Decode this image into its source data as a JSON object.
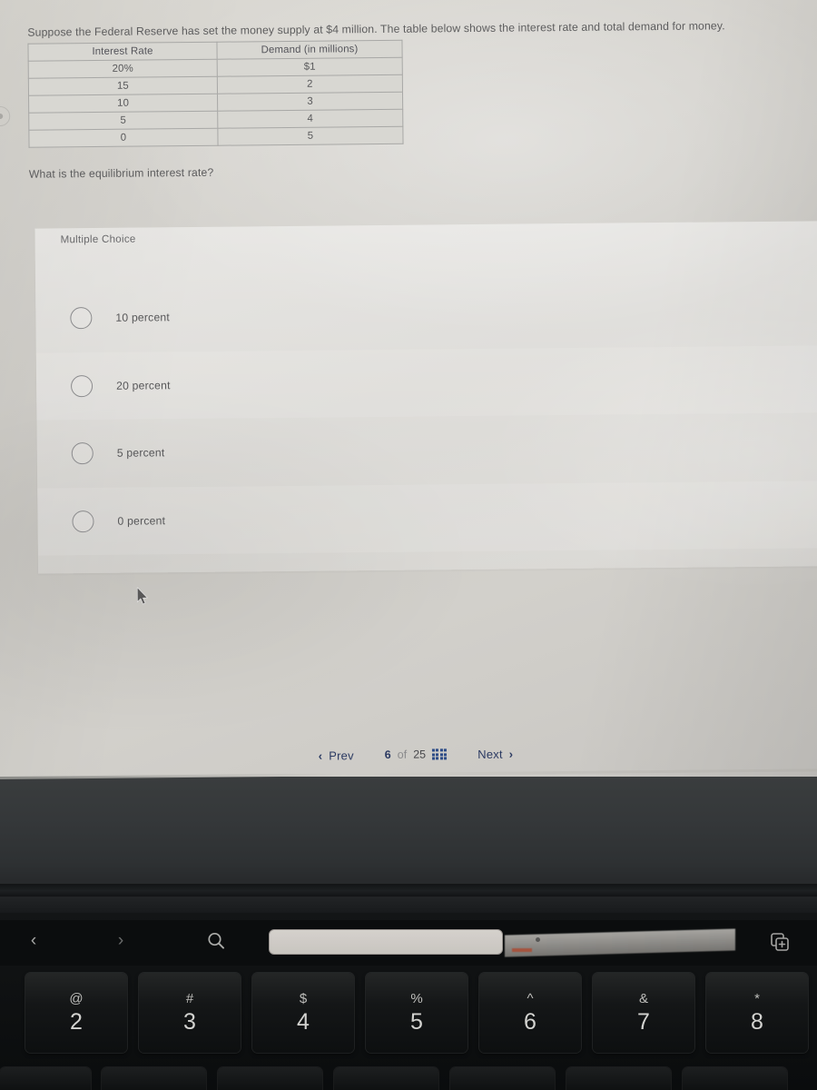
{
  "question": {
    "stem": "Suppose the Federal Reserve has set the money supply at $4 million. The table below shows the interest rate and total demand for money.",
    "prompt": "What is the equilibrium interest rate?",
    "table": {
      "headers": [
        "Interest Rate",
        "Demand (in millions)"
      ],
      "rows": [
        [
          "20%",
          "$1"
        ],
        [
          "15",
          "2"
        ],
        [
          "10",
          "3"
        ],
        [
          "5",
          "4"
        ],
        [
          "0",
          "5"
        ]
      ]
    }
  },
  "answer_card": {
    "type_label": "Multiple Choice",
    "options": [
      {
        "label": "10 percent",
        "selected": false
      },
      {
        "label": "20 percent",
        "selected": false
      },
      {
        "label": "5 percent",
        "selected": false
      },
      {
        "label": "0 percent",
        "selected": false
      }
    ]
  },
  "navigation": {
    "prev_label": "Prev",
    "next_label": "Next",
    "prev_chevron": "‹",
    "next_chevron": "›",
    "current_page": "6",
    "of_label": "of",
    "total_pages": "25",
    "grid_icon_name": "question-grid-icon",
    "accent_color": "#2b3a62"
  },
  "touchbar": {
    "back_icon": "‹",
    "forward_icon": "›",
    "search_icon_name": "search-icon",
    "newtab_icon_name": "new-tab-icon",
    "field_value": ""
  },
  "keyboard": {
    "keys": [
      {
        "symbol": "@",
        "number": "2"
      },
      {
        "symbol": "#",
        "number": "3"
      },
      {
        "symbol": "$",
        "number": "4"
      },
      {
        "symbol": "%",
        "number": "5"
      },
      {
        "symbol": "^",
        "number": "6"
      },
      {
        "symbol": "&",
        "number": "7"
      },
      {
        "symbol": "*",
        "number": "8"
      }
    ]
  }
}
